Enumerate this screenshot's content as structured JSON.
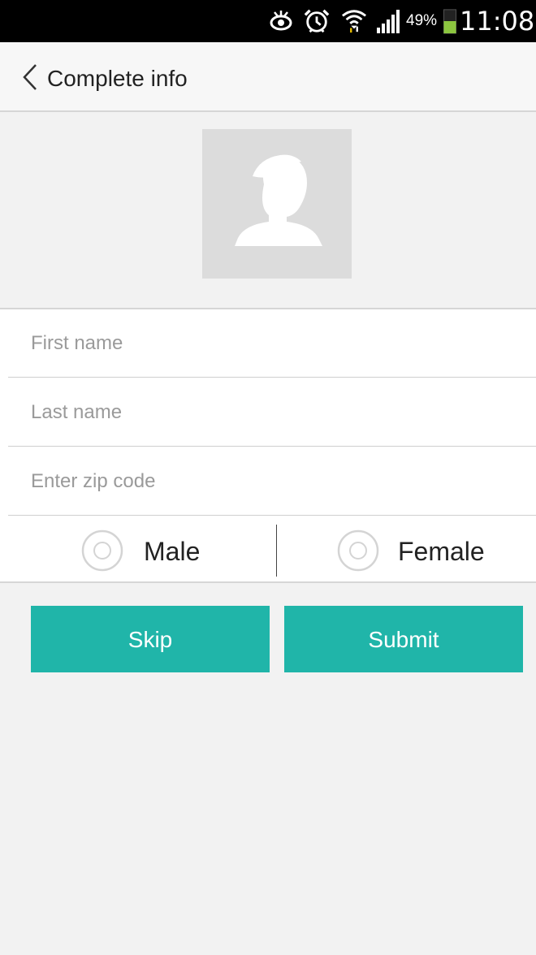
{
  "status_bar": {
    "icons": [
      "eye-icon",
      "alarm-icon",
      "wifi-icon",
      "signal-icon",
      "battery-icon"
    ],
    "battery_percent": "49%",
    "time": "11:08"
  },
  "header": {
    "back_icon": "chevron-left-icon",
    "title": "Complete info"
  },
  "avatar": {
    "icon": "person-silhouette-icon",
    "background": "#dcdcdc"
  },
  "form": {
    "first_name": {
      "placeholder": "First name",
      "value": ""
    },
    "last_name": {
      "placeholder": "Last name",
      "value": ""
    },
    "zip_code": {
      "placeholder": "Enter zip code",
      "value": ""
    },
    "gender": {
      "options": [
        {
          "label": "Male",
          "selected": false
        },
        {
          "label": "Female",
          "selected": false
        }
      ]
    }
  },
  "actions": {
    "skip_label": "Skip",
    "submit_label": "Submit",
    "accent_color": "#20b5a9"
  }
}
